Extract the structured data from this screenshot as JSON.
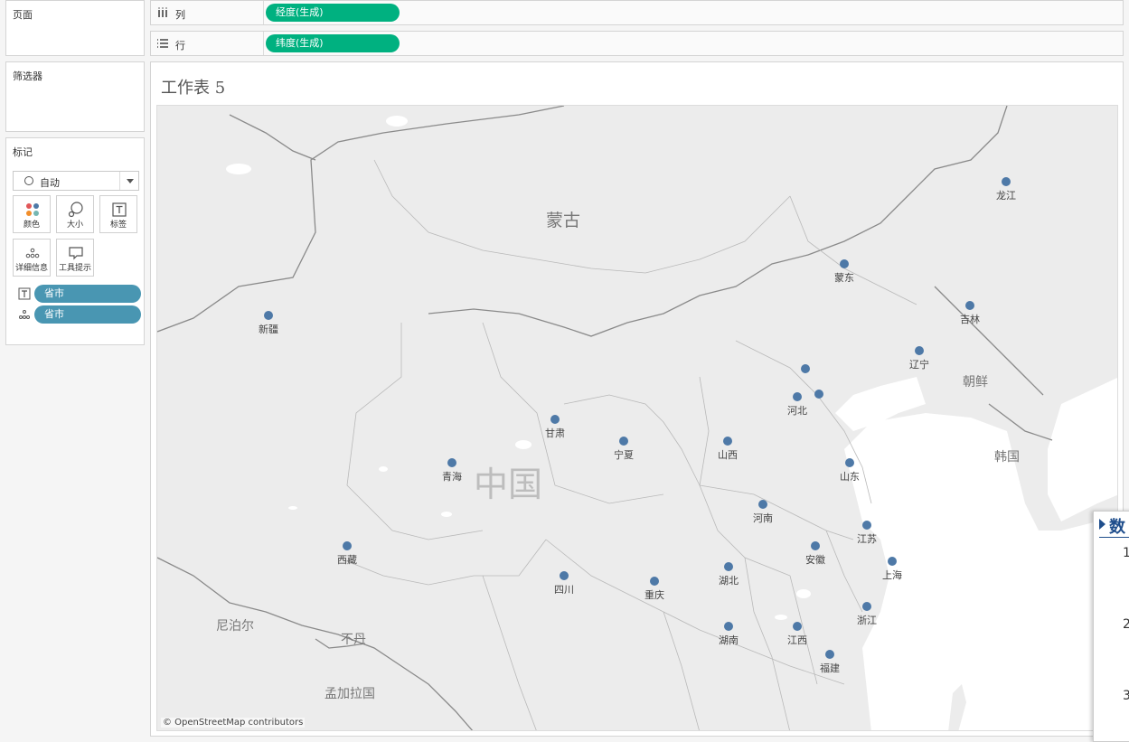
{
  "left": {
    "pages_title": "页面",
    "filters_title": "筛选器",
    "marks_title": "标记",
    "mark_type": "自动",
    "buttons": {
      "color": "颜色",
      "size": "大小",
      "label": "标签",
      "detail": "详细信息",
      "tooltip": "工具提示"
    },
    "pills": [
      "省市",
      "省市"
    ]
  },
  "shelves": {
    "columns_label": "列",
    "columns_pill": "经度(生成)",
    "rows_label": "行",
    "rows_pill": "纬度(生成)"
  },
  "sheet": {
    "title": "工作表 5",
    "attribution": "© OpenStreetMap contributors"
  },
  "map": {
    "country_labels": [
      "蒙古",
      "中国",
      "朝鲜",
      "韩国",
      "尼泊尔",
      "不丹",
      "孟加拉国"
    ],
    "points": [
      {
        "label": "龙江"
      },
      {
        "label": "蒙东"
      },
      {
        "label": "吉林"
      },
      {
        "label": "新疆"
      },
      {
        "label": "辽宁"
      },
      {
        "label": ""
      },
      {
        "label": ""
      },
      {
        "label": "河北"
      },
      {
        "label": "甘肃"
      },
      {
        "label": "宁夏"
      },
      {
        "label": "山西"
      },
      {
        "label": "青海"
      },
      {
        "label": "山东"
      },
      {
        "label": "河南"
      },
      {
        "label": "江苏"
      },
      {
        "label": "西藏"
      },
      {
        "label": "安徽"
      },
      {
        "label": "上海"
      },
      {
        "label": "四川"
      },
      {
        "label": "重庆"
      },
      {
        "label": "湖北"
      },
      {
        "label": "浙江"
      },
      {
        "label": "湖南"
      },
      {
        "label": "江西"
      },
      {
        "label": "福建"
      }
    ],
    "point_color": "#4e79a7"
  },
  "data_panel": {
    "title": "数",
    "numbers": [
      "1",
      "2",
      "3"
    ]
  }
}
